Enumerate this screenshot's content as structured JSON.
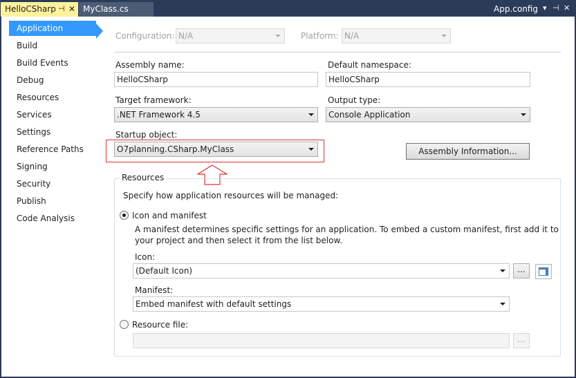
{
  "tabs": {
    "active": {
      "label": "HelloCSharp",
      "pin_icon": "pin-icon",
      "close_icon": "close-icon"
    },
    "inactive": {
      "label": "MyClass.cs"
    },
    "right": {
      "label": "App.config"
    }
  },
  "tabstrip_icons": [
    "dropdown-icon",
    "pin-icon",
    "close-icon"
  ],
  "nav": {
    "items": [
      {
        "label": "Application",
        "selected": true
      },
      {
        "label": "Build"
      },
      {
        "label": "Build Events"
      },
      {
        "label": "Debug"
      },
      {
        "label": "Resources"
      },
      {
        "label": "Services"
      },
      {
        "label": "Settings"
      },
      {
        "label": "Reference Paths"
      },
      {
        "label": "Signing"
      },
      {
        "label": "Security"
      },
      {
        "label": "Publish"
      },
      {
        "label": "Code Analysis"
      }
    ]
  },
  "config": {
    "configuration_label": "Configuration:",
    "configuration_value": "N/A",
    "platform_label": "Platform:",
    "platform_value": "N/A"
  },
  "form": {
    "assembly_name_label": "Assembly name:",
    "assembly_name_value": "HelloCSharp",
    "default_namespace_label": "Default namespace:",
    "default_namespace_value": "HelloCSharp",
    "target_framework_label": "Target framework:",
    "target_framework_value": ".NET Framework 4.5",
    "output_type_label": "Output type:",
    "output_type_value": "Console Application",
    "startup_object_label": "Startup object:",
    "startup_object_value": "O7planning.CSharp.MyClass",
    "assembly_info_button": "Assembly Information..."
  },
  "resources": {
    "group_title": "Resources",
    "description": "Specify how application resources will be managed:",
    "icon_manifest_label": "Icon and manifest",
    "icon_manifest_desc_1": "A manifest determines specific settings for an application. To embed a custom manifest, first add it to",
    "icon_manifest_desc_2": "your project and then select it from the list below.",
    "icon_label": "Icon:",
    "icon_value": "(Default Icon)",
    "browse_button": "...",
    "manifest_label": "Manifest:",
    "manifest_value": "Embed manifest with default settings",
    "resource_file_label": "Resource file:",
    "resource_file_value": "",
    "resource_browse_button": "..."
  },
  "colors": {
    "frame": "#2b3c59",
    "active_tab": "#fff29d",
    "selection": "#3399ff",
    "annotation": "#e03030"
  }
}
